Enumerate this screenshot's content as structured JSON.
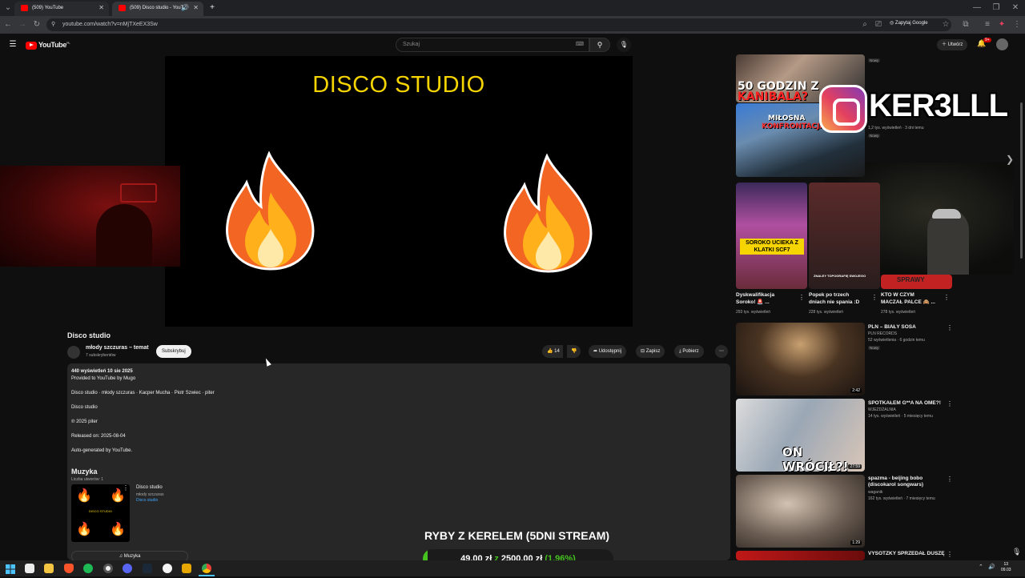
{
  "browser": {
    "tabs": [
      {
        "title": "(509) YouTube",
        "active": false
      },
      {
        "title": "(509) Disco studio - YouTu",
        "active": true
      }
    ],
    "url": "youtube.com/watch?v=nMjTXeEX3Sw",
    "ask_google": "Zapytaj Google"
  },
  "header": {
    "logo": "YouTube",
    "logo_country": "PL",
    "search_placeholder": "Szukaj",
    "create_label": "Utwórz",
    "notifications": "9+"
  },
  "player": {
    "title_text": "DISCO STUDIO"
  },
  "video": {
    "title": "Disco studio",
    "channel": "młody szczuras – temat",
    "subscribers": "7 subskrybentów",
    "subscribe_label": "Subskrybuj",
    "likes": "14",
    "share_label": "Udostępnij",
    "save_label": "Zapisz",
    "download_label": "Pobierz"
  },
  "description": {
    "stats": "440 wyświetleń  10 sie 2025",
    "provided": "Provided to YouTube by Mugo",
    "credits": "Disco studio · młody szczuras · Kacper Mucha · Piotr Szwiec · piter",
    "track": "Disco studio",
    "copyright": "℗ 2025 piter",
    "released": "Released on: 2025-08-04",
    "autogen": "Auto-generated by YouTube.",
    "music_heading": "Muzyka",
    "music_count": "Liczba utworów: 1",
    "music_track_title": "Disco studio",
    "music_track_artist": "młody szczuras",
    "music_track_album": "Disco studio",
    "music_thumb_text": "DISCO STUDIO",
    "music_button": "Muzyka"
  },
  "sidebar": {
    "top_overlays": [
      "50 GODZIN Z",
      "KANIBALA?",
      "MIŁOSNA",
      "KONFRONTACJA"
    ],
    "top_meta": [
      "Nowy",
      "Nowy"
    ],
    "top_meta_2": "1,2 tys. wyświetleń · 3 dni temu",
    "shorts": [
      {
        "title_line1": "Dyskwalifikacja",
        "title_line2": "Soroko! 🚨 ...",
        "views": "293 tys. wyświetleń",
        "overlay": "SOROKO UCIEKA Z KLATKI SCF7"
      },
      {
        "title_line1": "Popek po trzech",
        "title_line2": "dniach nie spania :D",
        "views": "228 tys. wyświetleń",
        "overlay": "ZNALEY TOPOGRAFIĘ SWOJEGO"
      },
      {
        "title_line1": "KTO W CZYM",
        "title_line2": "MACZAŁ PALCE 🙈 ...",
        "views": "278 tys. wyświetleń",
        "overlay": "SPRAWY"
      }
    ],
    "videos": [
      {
        "title_line1": "PLN – BIAŁY SOSA",
        "title_line2": "",
        "channel": "PLN RECORDS",
        "meta": "52 wyświetlenia · 6 godzin temu",
        "badge": "Nowy",
        "duration": "2:42"
      },
      {
        "title_line1": "SPOTKAŁEM G**A NA OME?!",
        "title_line2": "",
        "channel": "WJEŻDŻALNIA",
        "meta": "14 tys. wyświetleń · 5 miesięcy temu",
        "badge": "",
        "duration": "27:59",
        "overlay": "ON WRÓCIŁ?!"
      },
      {
        "title_line1": "spazma - beijing bobo",
        "title_line2": "(discokarol songwars)",
        "channel": "waganik",
        "meta": "162 tys. wyświetleń · 7 miesięcy temu",
        "badge": "",
        "duration": "1:29"
      },
      {
        "title_line1": "VYSOTZKY SPRZEDAŁ DUSZĘ",
        "title_line2": "",
        "channel": "",
        "meta": "",
        "badge": "",
        "duration": ""
      }
    ]
  },
  "instagram": {
    "handle": "KER3LLL"
  },
  "donation": {
    "title": "RYBY Z KERELEM (5DNI STREAM)",
    "amount": "49,00 zł",
    "separator": "z",
    "goal": "2500,00 zł",
    "percent": "(1.96%)",
    "progress": 0.0196
  },
  "taskbar": {
    "time": "13",
    "date": "09.03",
    "icons": [
      "start-icon",
      "store-icon",
      "file-explorer-icon",
      "brave-icon",
      "spotify-icon",
      "obs-icon",
      "discord-icon",
      "steam-icon",
      "rockstar-icon",
      "app-icon",
      "chrome-icon"
    ]
  },
  "colors": {
    "accent_red": "#ff0000",
    "player_title": "#f5d400",
    "donation_green": "#46c21e"
  }
}
